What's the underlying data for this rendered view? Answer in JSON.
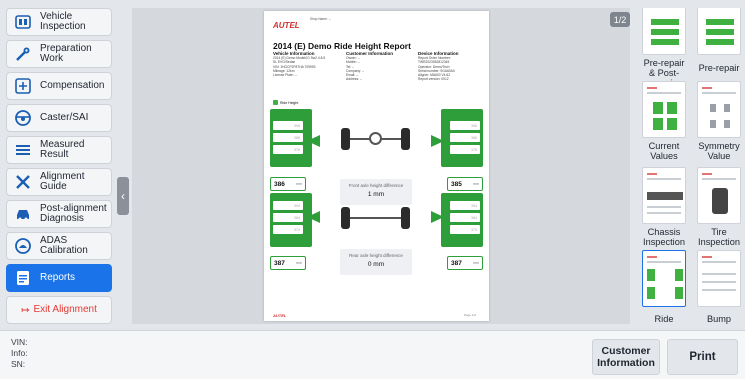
{
  "sidebar": {
    "items": [
      {
        "label": "Vehicle Inspection",
        "icon": "vehicle-inspection-icon"
      },
      {
        "label": "Preparation Work",
        "icon": "wrench-icon"
      },
      {
        "label": "Compensation",
        "icon": "compensation-icon"
      },
      {
        "label": "Caster/SAI",
        "icon": "steering-wheel-icon"
      },
      {
        "label": "Measured Result",
        "icon": "list-icon"
      },
      {
        "label": "Alignment Guide",
        "icon": "tools-icon"
      },
      {
        "label": "Post-alignment Diagnosis",
        "icon": "car-icon"
      },
      {
        "label": "ADAS Calibration",
        "icon": "adas-icon"
      },
      {
        "label": "Reports",
        "icon": "report-icon"
      }
    ],
    "exit_label": "Exit Alignment"
  },
  "viewer": {
    "page_indicator": "1/2",
    "report": {
      "logo": "AUTEL",
      "title": "2014 (E) Demo Ride Height Report",
      "shop_name_label": "Shop Name: --",
      "col_vehicle": {
        "heading": "Vehicle Information",
        "lines": [
          "2014 (E) Demo Model/IO Sw2.4.8.5",
          "SL EVO/Sedan",
          "VIN: 1HGCP2F87HA 709993",
          "Mileage: 12km",
          "License Plate: --"
        ]
      },
      "col_customer": {
        "heading": "Customer Information",
        "lines": [
          "Owner: --",
          "Mobile: --",
          "Tel: --",
          "Company: --",
          "Email: --",
          "Address: --"
        ]
      },
      "col_device": {
        "heading": "Device Information",
        "lines": [
          "Report Order Number:",
          "TWR2023052812345",
          "Operator: Demo/Tech",
          "Serial number: 9GA60A0",
          "Aligner: MA600 V4.62",
          "Report version: 0012"
        ]
      },
      "section_label": "Ride Height",
      "front": {
        "left_slots": [
          "396",
          "386",
          "376"
        ],
        "right_slots": [
          "396",
          "386",
          "376"
        ],
        "left_value": "386",
        "right_value": "385",
        "unit": "mm",
        "diff_label": "Front axle height difference",
        "diff_value": "1 mm"
      },
      "rear": {
        "left_slots": [
          "394",
          "384",
          "374"
        ],
        "right_slots": [
          "394",
          "384",
          "374"
        ],
        "left_value": "387",
        "right_value": "387",
        "unit": "mm",
        "diff_label": "Rear axle height difference",
        "diff_value": "0 mm"
      },
      "footer_logo": "AUTEL",
      "footer_page": "Page 1/2"
    }
  },
  "thumbnails": [
    {
      "label": "Pre-repair & Post-repair"
    },
    {
      "label": "Pre-repair"
    },
    {
      "label": "Current Values"
    },
    {
      "label": "Symmetry Value"
    },
    {
      "label": "Chassis Inspection"
    },
    {
      "label": "Tire Inspection"
    },
    {
      "label": "Ride Height"
    },
    {
      "label": "Bump Steer"
    }
  ],
  "bottom": {
    "vin_label": "VIN:",
    "info_label": "Info:",
    "sn_label": "SN:",
    "customer_button": "Customer Information",
    "print_button": "Print"
  },
  "colors": {
    "accent": "#1a73e8",
    "green": "#2e9e3a",
    "exit": "#e53935"
  }
}
